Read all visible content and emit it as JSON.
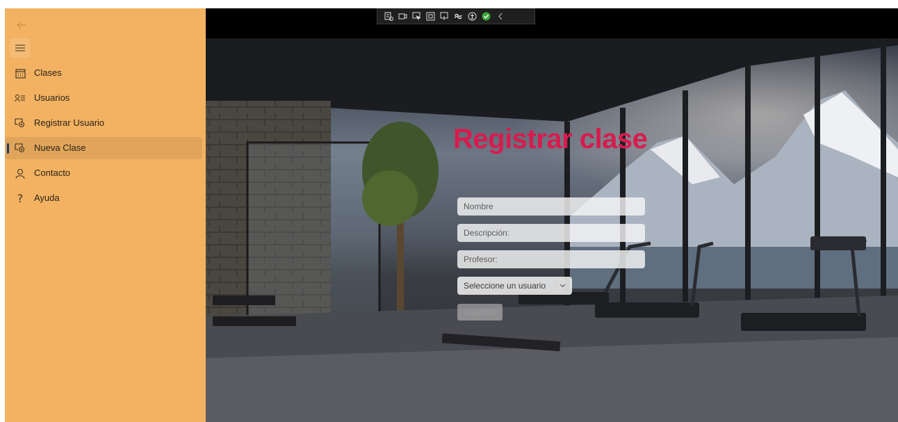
{
  "sidebar": {
    "back_icon": "back-arrow-icon",
    "menu_icon": "hamburger-icon",
    "items": [
      {
        "label": "Clases",
        "icon": "calendar-icon"
      },
      {
        "label": "Usuarios",
        "icon": "people-list-icon"
      },
      {
        "label": "Registrar Usuario",
        "icon": "register-icon"
      },
      {
        "label": "Nueva Clase",
        "icon": "register-icon",
        "selected": true
      },
      {
        "label": "Contacto",
        "icon": "person-icon"
      },
      {
        "label": "Ayuda",
        "icon": "help-icon"
      }
    ],
    "bg_color": "#f2b262"
  },
  "toolbar": {
    "icons": [
      "live-visual-tree-icon",
      "display-layout-icon",
      "select-element-icon",
      "adorner-icon",
      "track-focus-icon",
      "binding-icon",
      "accessibility-icon",
      "hot-reload-check-icon",
      "collapse-chevron-icon"
    ]
  },
  "form": {
    "title": "Registrar clase",
    "title_color": "#d81b4e",
    "nombre_placeholder": "Nombre",
    "descripcion_placeholder": "Descripción:",
    "profesor_placeholder": "Profesor:",
    "usuario_select": "Seleccione un usuario",
    "save_label": "Guardar"
  }
}
